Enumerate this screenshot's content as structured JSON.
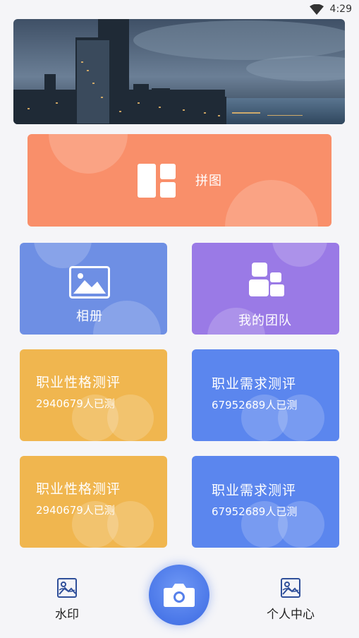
{
  "status_bar": {
    "time": "4:29"
  },
  "banner": {
    "image": "city-skyline-banner"
  },
  "puzzle_card": {
    "label": "拼图",
    "color": "#f98f6a"
  },
  "album_card": {
    "label": "相册",
    "color": "#6e8fe4"
  },
  "team_card": {
    "label": "我的团队",
    "color": "#9a7ae6"
  },
  "tests": [
    {
      "title": "职业性格测评",
      "count": "2940679人已测",
      "color": "#f0b64f"
    },
    {
      "title": "职业需求测评",
      "count": "67952689人已测",
      "color": "#5b86ee"
    },
    {
      "title": "职业性格测评",
      "count": "2940679人已测",
      "color": "#f0b64f"
    },
    {
      "title": "职业需求测评",
      "count": "67952689人已测",
      "color": "#5b86ee"
    }
  ],
  "bottom_nav": {
    "watermark_label": "水印",
    "profile_label": "个人中心"
  }
}
